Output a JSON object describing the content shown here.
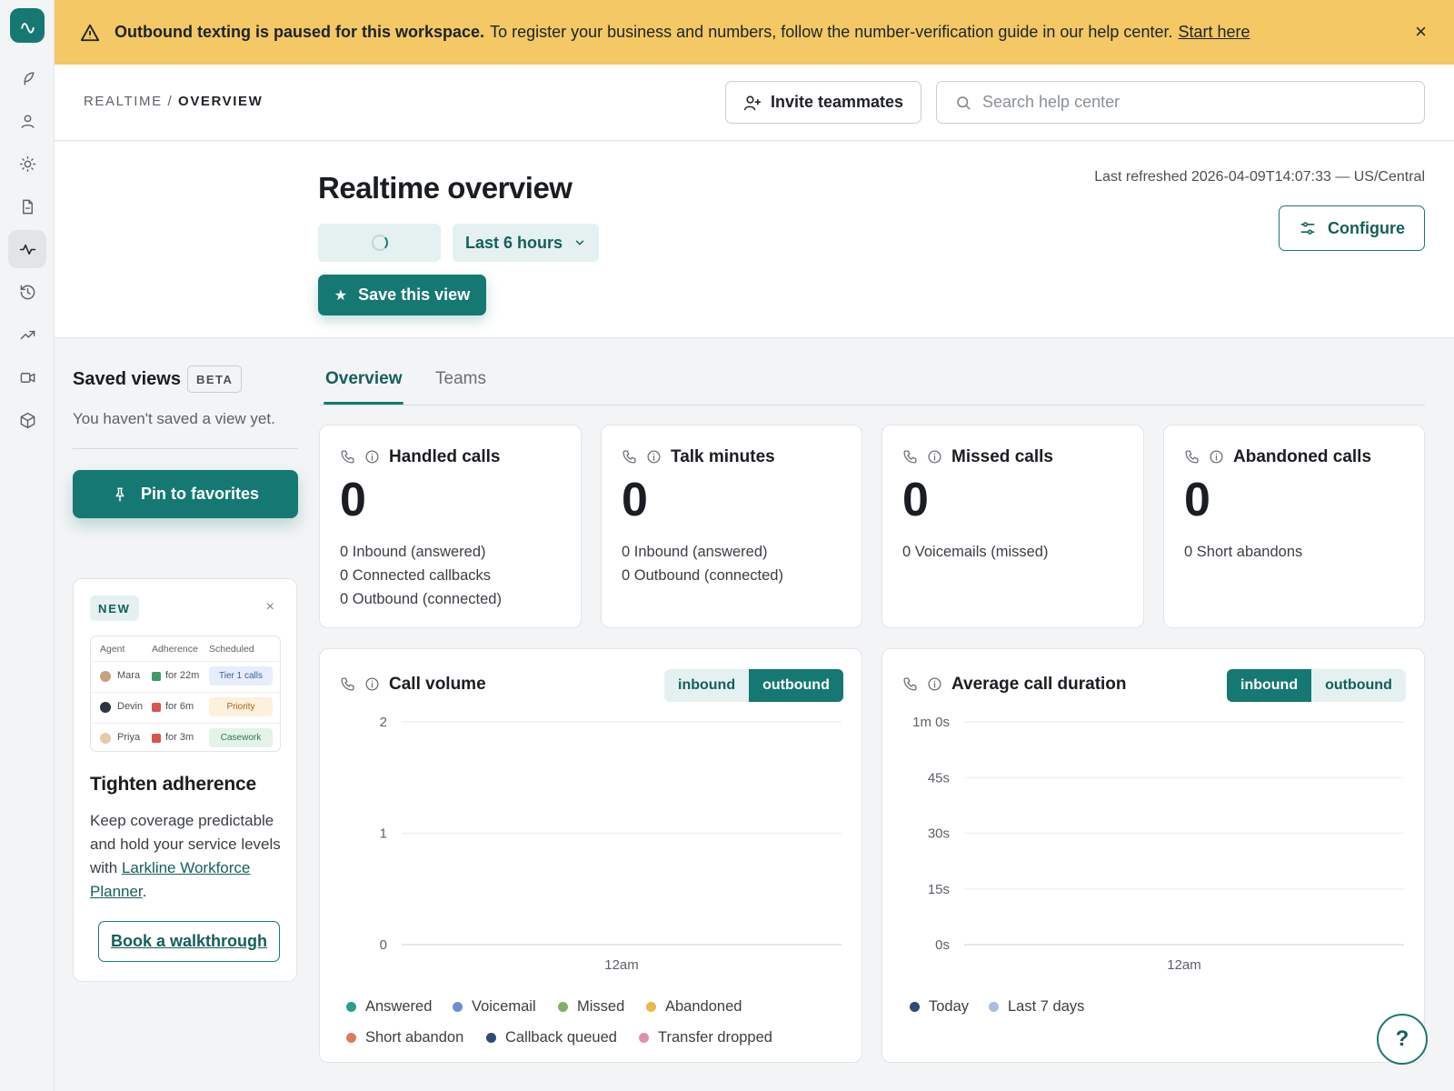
{
  "banner": {
    "bold": "Outbound texting is paused for this workspace.",
    "text": "To register your business and numbers, follow the number-verification guide in our help center.",
    "link": "Start here",
    "close": "×"
  },
  "header": {
    "breadcrumb_parent": "REALTIME",
    "breadcrumb_sep": "/",
    "breadcrumb_current": "OVERVIEW",
    "invite_label": "Invite teammates",
    "search_placeholder": "Search help center"
  },
  "page": {
    "title": "Realtime overview",
    "last_refreshed": "Last refreshed 2026-04-09T14:07:33 — US/Central",
    "configure_label": "Configure",
    "time_range": "Last 6 hours",
    "save_view_label": "Save this view"
  },
  "sidebar": {
    "saved_views_title": "Saved views",
    "beta_badge": "BETA",
    "empty_text": "You haven't saved a view yet.",
    "pin_label": "Pin to favorites",
    "rail_icons": [
      "feather-icon",
      "user-icon",
      "sun-icon",
      "document-icon",
      "activity-icon",
      "history-icon",
      "trend-icon",
      "video-icon",
      "cube-icon"
    ],
    "promo": {
      "badge": "NEW",
      "close": "×",
      "mini_headers": [
        "Agent",
        "Adherence",
        "Scheduled"
      ],
      "mini_rows": [
        {
          "agent": "Mara",
          "duration": "for 22m",
          "tag": "Tier 1 calls",
          "status_color": "#3f9a63",
          "tag_bg": "#e6eefb",
          "tag_fg": "#3a5ca8"
        },
        {
          "agent": "Devin",
          "duration": "for 6m",
          "tag": "Priority",
          "status_color": "#d9534f",
          "tag_bg": "#fdf0dc",
          "tag_fg": "#a8661b"
        },
        {
          "agent": "Priya",
          "duration": "for 3m",
          "tag": "Casework",
          "status_color": "#d9534f",
          "tag_bg": "#e3f3ea",
          "tag_fg": "#2f7a4d"
        }
      ],
      "title": "Tighten adherence",
      "body_before": "Keep coverage predictable and hold your service levels with ",
      "body_link": "Larkline Workforce Planner",
      "body_after": ".",
      "cta": "Book a walkthrough"
    }
  },
  "tabs": [
    {
      "label": "Overview",
      "active": true
    },
    {
      "label": "Teams",
      "active": false
    }
  ],
  "metrics": [
    {
      "title": "Handled calls",
      "value": "0",
      "lines": [
        "0 Inbound (answered)",
        "0 Connected callbacks",
        "0 Outbound (connected)"
      ]
    },
    {
      "title": "Talk minutes",
      "value": "0",
      "lines": [
        "0 Inbound (answered)",
        "0 Outbound (connected)"
      ]
    },
    {
      "title": "Missed calls",
      "value": "0",
      "lines": [
        "0 Voicemails (missed)"
      ]
    },
    {
      "title": "Abandoned calls",
      "value": "0",
      "lines": [
        "0 Short abandons"
      ]
    }
  ],
  "charts": {
    "volume": {
      "title": "Call volume",
      "toggle": [
        "inbound",
        "outbound"
      ],
      "selected": "outbound",
      "legend": [
        {
          "name": "Answered",
          "color": "#2a9d8f"
        },
        {
          "name": "Voicemail",
          "color": "#6b8fd6"
        },
        {
          "name": "Missed",
          "color": "#7fb069"
        },
        {
          "name": "Abandoned",
          "color": "#e9b949"
        },
        {
          "name": "Short abandon",
          "color": "#e07a5f"
        },
        {
          "name": "Callback queued",
          "color": "#2f4a7a"
        },
        {
          "name": "Transfer dropped",
          "color": "#e08fb0"
        }
      ]
    },
    "duration": {
      "title": "Average call duration",
      "toggle": [
        "inbound",
        "outbound"
      ],
      "selected": "inbound",
      "legend": [
        {
          "name": "Today",
          "color": "#2f4a7a"
        },
        {
          "name": "Last 7 days",
          "color": "#a8bde0"
        }
      ]
    }
  },
  "chart_data": [
    {
      "type": "line",
      "title": "Call volume",
      "x": [
        "12am"
      ],
      "ylim": [
        0,
        2
      ],
      "yticks": [
        "0",
        "1",
        "2"
      ],
      "grid": true,
      "legend_position": "bottom",
      "series": [
        {
          "name": "Answered",
          "values": []
        },
        {
          "name": "Voicemail",
          "values": []
        },
        {
          "name": "Missed",
          "values": []
        },
        {
          "name": "Abandoned",
          "values": []
        },
        {
          "name": "Short abandon",
          "values": []
        },
        {
          "name": "Callback queued",
          "values": []
        },
        {
          "name": "Transfer dropped",
          "values": []
        }
      ]
    },
    {
      "type": "line",
      "title": "Average call duration",
      "x": [
        "12am"
      ],
      "ylim": [
        0,
        60
      ],
      "yticks": [
        "0s",
        "15s",
        "30s",
        "45s",
        "1m 0s"
      ],
      "grid": true,
      "legend_position": "bottom",
      "series": [
        {
          "name": "Today",
          "values": []
        },
        {
          "name": "Last 7 days",
          "values": []
        }
      ]
    }
  ],
  "help_button": "?"
}
